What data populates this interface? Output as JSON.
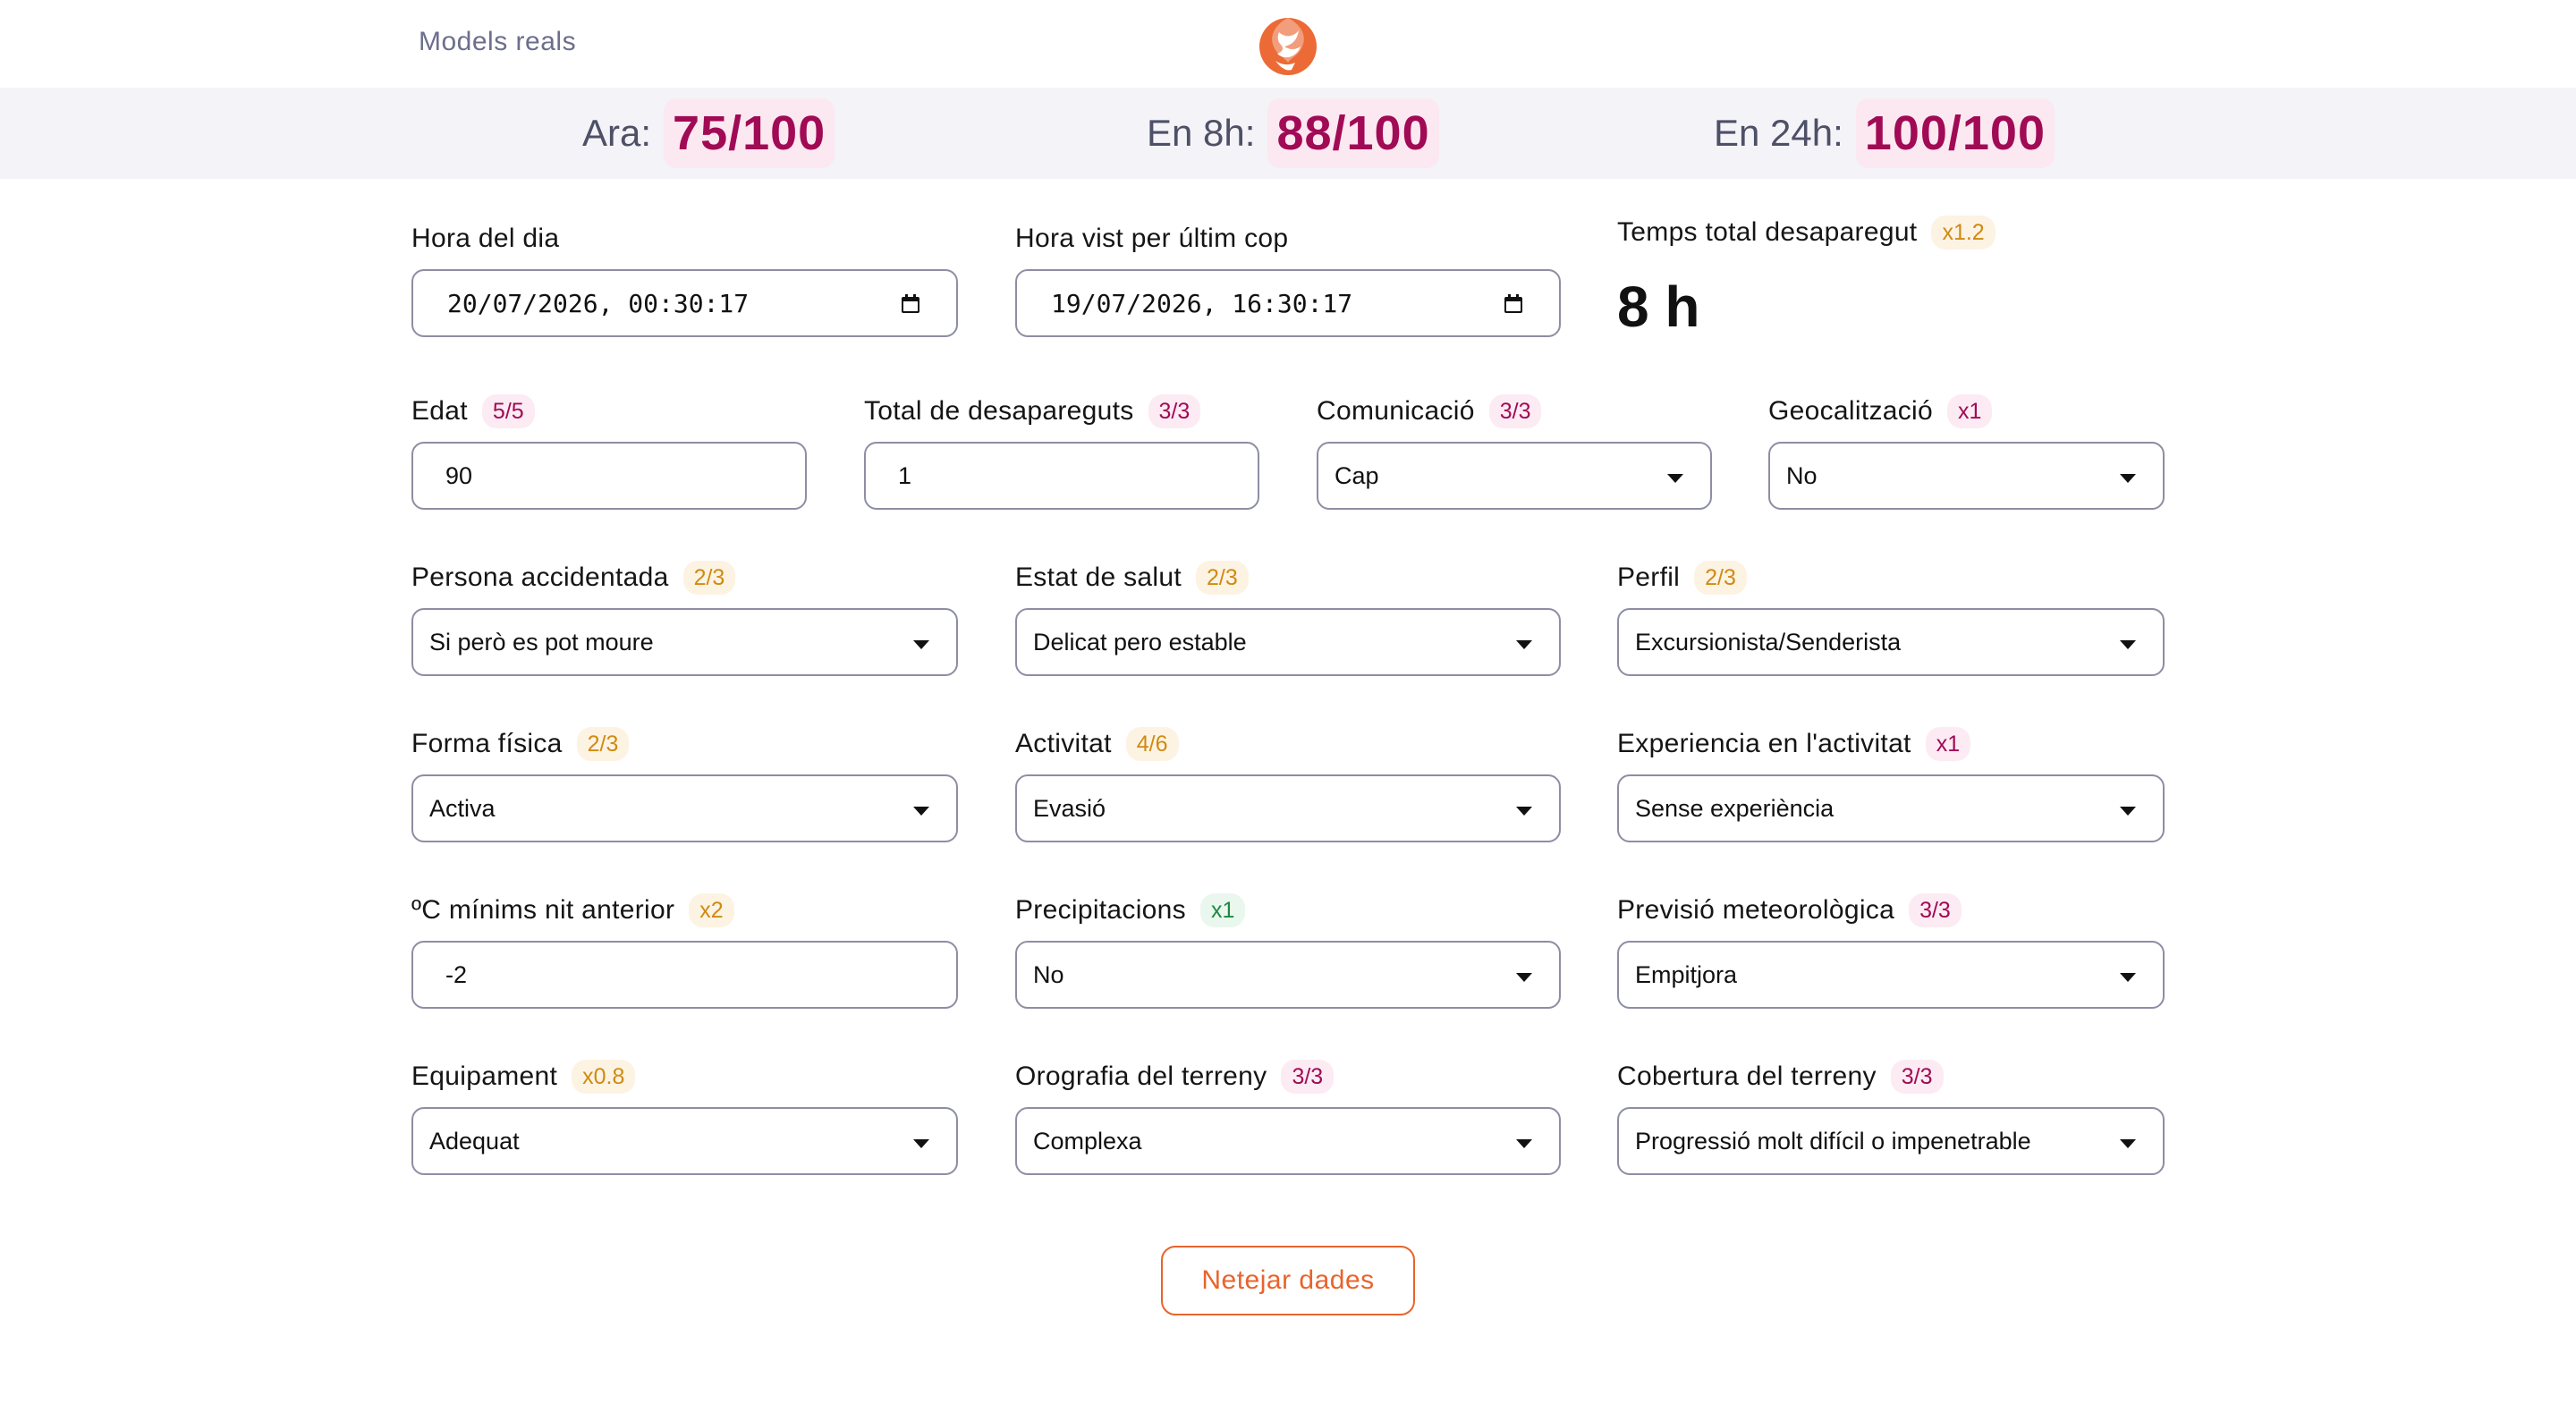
{
  "header": {
    "models_link": "Models reals"
  },
  "scores": [
    {
      "label": "Ara:",
      "value": "75/100"
    },
    {
      "label": "En 8h:",
      "value": "88/100"
    },
    {
      "label": "En 24h:",
      "value": "100/100"
    }
  ],
  "form": {
    "hora_dia": {
      "label": "Hora del dia",
      "value": "20/07/2026, 00:30:17"
    },
    "hora_vist": {
      "label": "Hora vist per últim cop",
      "value": "19/07/2026, 16:30:17"
    },
    "temps_total": {
      "label": "Temps total desaparegut",
      "badge": "x1.2",
      "value": "8 h"
    },
    "edat": {
      "label": "Edat",
      "badge": "5/5",
      "value": "90"
    },
    "total_desapareguts": {
      "label": "Total de desapareguts",
      "badge": "3/3",
      "value": "1"
    },
    "comunicacio": {
      "label": "Comunicació",
      "badge": "3/3",
      "value": "Cap"
    },
    "geocalitzacio": {
      "label": "Geocalització",
      "badge": "x1",
      "value": "No"
    },
    "persona_accidentada": {
      "label": "Persona accidentada",
      "badge": "2/3",
      "value": "Si però es pot moure"
    },
    "estat_salut": {
      "label": "Estat de salut",
      "badge": "2/3",
      "value": "Delicat pero estable"
    },
    "perfil": {
      "label": "Perfil",
      "badge": "2/3",
      "value": "Excursionista/Senderista"
    },
    "forma_fisica": {
      "label": "Forma física",
      "badge": "2/3",
      "value": "Activa"
    },
    "activitat": {
      "label": "Activitat",
      "badge": "4/6",
      "value": "Evasió"
    },
    "experiencia": {
      "label": "Experiencia en l'activitat",
      "badge": "x1",
      "value": "Sense experiència"
    },
    "temp_minima": {
      "label": "ºC mínims nit anterior",
      "badge": "x2",
      "value": "-2"
    },
    "precipitacions": {
      "label": "Precipitacions",
      "badge": "x1",
      "value": "No"
    },
    "previsio": {
      "label": "Previsió meteorològica",
      "badge": "3/3",
      "value": "Empitjora"
    },
    "equipament": {
      "label": "Equipament",
      "badge": "x0.8",
      "value": "Adequat"
    },
    "orografia": {
      "label": "Orografia del terreny",
      "badge": "3/3",
      "value": "Complexa"
    },
    "cobertura": {
      "label": "Cobertura del terreny",
      "badge": "3/3",
      "value": "Progressió molt difícil o impenetrable"
    }
  },
  "actions": {
    "clear_label": "Netejar dades"
  },
  "colors": {
    "accent": "#e8642c",
    "score": "#a10a55",
    "badge_pink_bg": "#fcebf3",
    "badge_orange_text": "#d08a12",
    "badge_green_text": "#1c8a3e"
  }
}
